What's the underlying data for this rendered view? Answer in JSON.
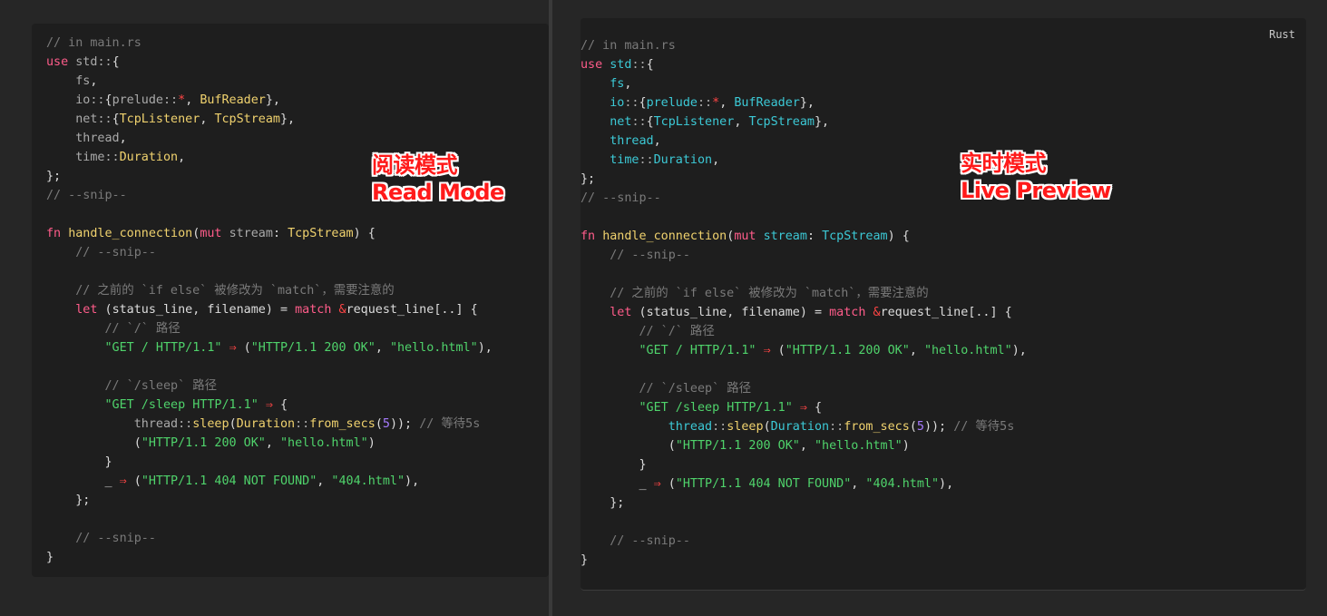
{
  "language_label": "Rust",
  "annotations": {
    "read_mode": {
      "title": "阅读模式",
      "subtitle": "Read Mode"
    },
    "live_preview": {
      "title": "实时模式",
      "subtitle": "Live Preview"
    }
  },
  "code_lines": [
    [
      [
        "c",
        "// in main.rs"
      ]
    ],
    [
      [
        "k",
        "use"
      ],
      [
        "p",
        " "
      ],
      [
        "m",
        "std"
      ],
      [
        "pu",
        "::"
      ],
      [
        "p",
        "{"
      ]
    ],
    [
      [
        "p",
        "    "
      ],
      [
        "m",
        "fs"
      ],
      [
        "p",
        ","
      ]
    ],
    [
      [
        "p",
        "    "
      ],
      [
        "m",
        "io"
      ],
      [
        "pu",
        "::"
      ],
      [
        "p",
        "{"
      ],
      [
        "m",
        "prelude"
      ],
      [
        "pu",
        "::"
      ],
      [
        "op",
        "*"
      ],
      [
        "p",
        ", "
      ],
      [
        "t",
        "BufReader"
      ],
      [
        "p",
        "},"
      ]
    ],
    [
      [
        "p",
        "    "
      ],
      [
        "m",
        "net"
      ],
      [
        "pu",
        "::"
      ],
      [
        "p",
        "{"
      ],
      [
        "t",
        "TcpListener"
      ],
      [
        "p",
        ", "
      ],
      [
        "t",
        "TcpStream"
      ],
      [
        "p",
        "},"
      ]
    ],
    [
      [
        "p",
        "    "
      ],
      [
        "m",
        "thread"
      ],
      [
        "p",
        ","
      ]
    ],
    [
      [
        "p",
        "    "
      ],
      [
        "m",
        "time"
      ],
      [
        "pu",
        "::"
      ],
      [
        "t",
        "Duration"
      ],
      [
        "p",
        ","
      ]
    ],
    [
      [
        "p",
        "};"
      ]
    ],
    [
      [
        "c",
        "// --snip--"
      ]
    ],
    [],
    [
      [
        "k",
        "fn"
      ],
      [
        "p",
        " "
      ],
      [
        "fn",
        "handle_connection"
      ],
      [
        "p",
        "("
      ],
      [
        "k",
        "mut"
      ],
      [
        "p",
        " "
      ],
      [
        "m",
        "stream"
      ],
      [
        "p",
        ": "
      ],
      [
        "t",
        "TcpStream"
      ],
      [
        "p",
        ") {"
      ]
    ],
    [
      [
        "p",
        "    "
      ],
      [
        "c",
        "// --snip--"
      ]
    ],
    [],
    [
      [
        "p",
        "    "
      ],
      [
        "c",
        "// 之前的 `if else` 被修改为 `match`，需要注意的"
      ]
    ],
    [
      [
        "p",
        "    "
      ],
      [
        "k",
        "let"
      ],
      [
        "p",
        " ("
      ],
      [
        "v",
        "status_line"
      ],
      [
        "p",
        ", "
      ],
      [
        "v",
        "filename"
      ],
      [
        "p",
        ") = "
      ],
      [
        "k",
        "match"
      ],
      [
        "p",
        " "
      ],
      [
        "op",
        "&"
      ],
      [
        "v",
        "request_line"
      ],
      [
        "p",
        "[..] {"
      ]
    ],
    [
      [
        "p",
        "        "
      ],
      [
        "c",
        "// `/` 路径"
      ]
    ],
    [
      [
        "p",
        "        "
      ],
      [
        "s",
        "\"GET / HTTP/1.1\""
      ],
      [
        "p",
        " "
      ],
      [
        "op",
        "⇒"
      ],
      [
        "p",
        " ("
      ],
      [
        "s",
        "\"HTTP/1.1 200 OK\""
      ],
      [
        "p",
        ", "
      ],
      [
        "s",
        "\"hello.html\""
      ],
      [
        "p",
        "),"
      ]
    ],
    [],
    [
      [
        "p",
        "        "
      ],
      [
        "c",
        "// `/sleep` 路径"
      ]
    ],
    [
      [
        "p",
        "        "
      ],
      [
        "s",
        "\"GET /sleep HTTP/1.1\""
      ],
      [
        "p",
        " "
      ],
      [
        "op",
        "⇒"
      ],
      [
        "p",
        " {"
      ]
    ],
    [
      [
        "p",
        "            "
      ],
      [
        "m",
        "thread"
      ],
      [
        "pu",
        "::"
      ],
      [
        "fn",
        "sleep"
      ],
      [
        "p",
        "("
      ],
      [
        "t",
        "Duration"
      ],
      [
        "pu",
        "::"
      ],
      [
        "fn",
        "from_secs"
      ],
      [
        "p",
        "("
      ],
      [
        "n",
        "5"
      ],
      [
        "p",
        "));"
      ],
      [
        "p",
        " "
      ],
      [
        "c",
        "// 等待5s"
      ]
    ],
    [
      [
        "p",
        "            ("
      ],
      [
        "s",
        "\"HTTP/1.1 200 OK\""
      ],
      [
        "p",
        ", "
      ],
      [
        "s",
        "\"hello.html\""
      ],
      [
        "p",
        ")"
      ]
    ],
    [
      [
        "p",
        "        }"
      ]
    ],
    [
      [
        "p",
        "        "
      ],
      [
        "v",
        "_"
      ],
      [
        "p",
        " "
      ],
      [
        "op",
        "⇒"
      ],
      [
        "p",
        " ("
      ],
      [
        "s",
        "\"HTTP/1.1 404 NOT FOUND\""
      ],
      [
        "p",
        ", "
      ],
      [
        "s",
        "\"404.html\""
      ],
      [
        "p",
        "),"
      ]
    ],
    [
      [
        "p",
        "    };"
      ]
    ],
    [],
    [
      [
        "p",
        "    "
      ],
      [
        "c",
        "// --snip--"
      ]
    ],
    [
      [
        "p",
        "}"
      ]
    ]
  ]
}
